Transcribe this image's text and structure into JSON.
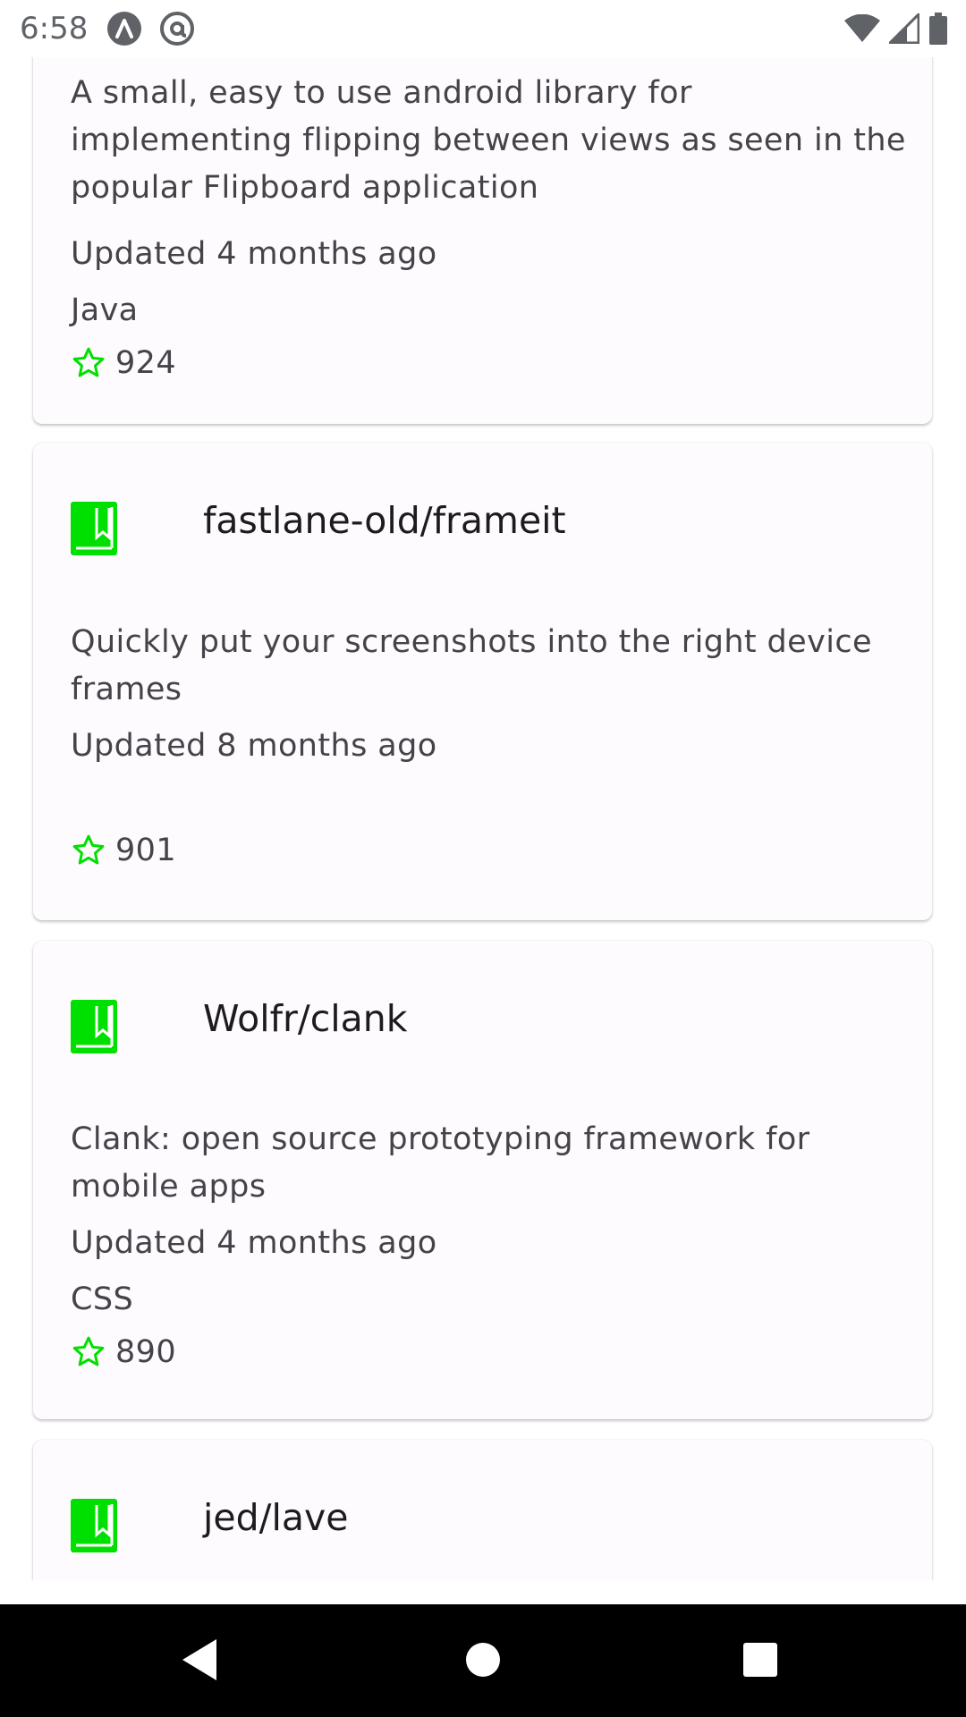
{
  "status_bar": {
    "time": "6:58",
    "left_icons": [
      "app-notification-icon",
      "at-sign-notification-icon"
    ],
    "right_icons": [
      "wifi-icon",
      "signal-icon",
      "battery-icon"
    ]
  },
  "colors": {
    "accent_green": "#00e000",
    "card_background": "#fefbfe",
    "text_primary": "#1c1b1f",
    "text_secondary": "#45424a"
  },
  "repos": [
    {
      "title": "",
      "description": "A small, easy to use android library for implementing flipping between views as seen in the popular Flipboard application",
      "updated": "Updated 4 months ago",
      "language": "Java",
      "stars": "924"
    },
    {
      "title": "fastlane-old/frameit",
      "description": "Quickly put your screenshots into the right device frames",
      "updated": "Updated 8 months ago",
      "language": "",
      "stars": "901"
    },
    {
      "title": "Wolfr/clank",
      "description": "Clank: open source prototyping framework for mobile apps",
      "updated": "Updated 4 months ago",
      "language": "CSS",
      "stars": "890"
    },
    {
      "title": "jed/lave",
      "description": "",
      "updated": "",
      "language": "",
      "stars": ""
    }
  ],
  "nav_bar": {
    "buttons": [
      "back-icon",
      "home-icon",
      "recents-icon"
    ]
  }
}
